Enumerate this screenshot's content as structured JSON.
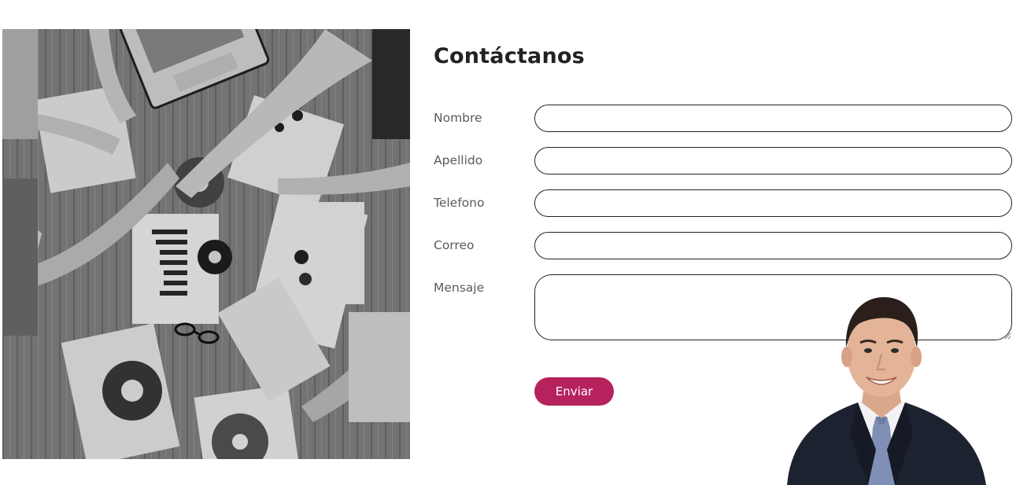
{
  "contact": {
    "title": "Contáctanos",
    "fields": [
      {
        "label": "Nombre",
        "value": ""
      },
      {
        "label": "Apellido",
        "value": ""
      },
      {
        "label": "Telefono",
        "value": ""
      },
      {
        "label": "Correo",
        "value": ""
      },
      {
        "label": "Mensaje",
        "value": ""
      }
    ],
    "submit_label": "Enviar"
  },
  "colors": {
    "accent": "#b5225c",
    "title": "#222222",
    "label": "#5a5a5a",
    "field_border": "#222222"
  },
  "images": {
    "left_photo": "grayscale-team-meeting-photo",
    "right_photo": "smiling-businessman-photo"
  }
}
